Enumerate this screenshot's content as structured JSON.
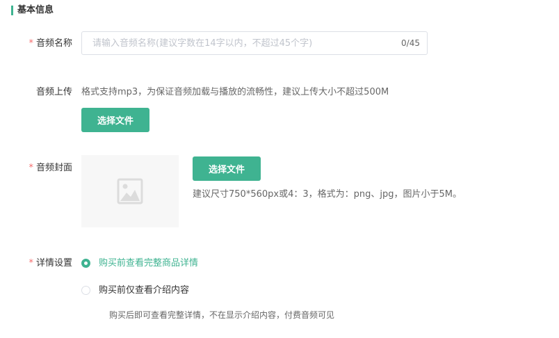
{
  "section": {
    "title": "基本信息"
  },
  "form": {
    "required_mark": "*",
    "name": {
      "label": "音频名称",
      "placeholder": "请输入音频名称(建议字数在14字以内，不超过45个字)",
      "value": "",
      "counter": "0/45"
    },
    "upload": {
      "label": "音频上传",
      "hint": "格式支持mp3，为保证音频加载与播放的流畅性，建议上传大小不超过500M",
      "button_label": "选择文件"
    },
    "cover": {
      "label": "音频封面",
      "button_label": "选择文件",
      "hint": "建议尺寸750*560px或4：3，格式为：png、jpg，图片小于5M。",
      "placeholder_icon": "image-placeholder-icon"
    },
    "detail": {
      "label": "详情设置",
      "options": [
        {
          "label": "购买前查看完整商品详情",
          "checked": true
        },
        {
          "label": "购买前仅查看介绍内容",
          "checked": false
        }
      ],
      "note": "购买后即可查看完整详情，不在显示介绍内容，付费音频可见"
    }
  },
  "colors": {
    "accent": "#3fb391",
    "required": "#f56c6c",
    "cover_bg": "#f7f7f7"
  }
}
